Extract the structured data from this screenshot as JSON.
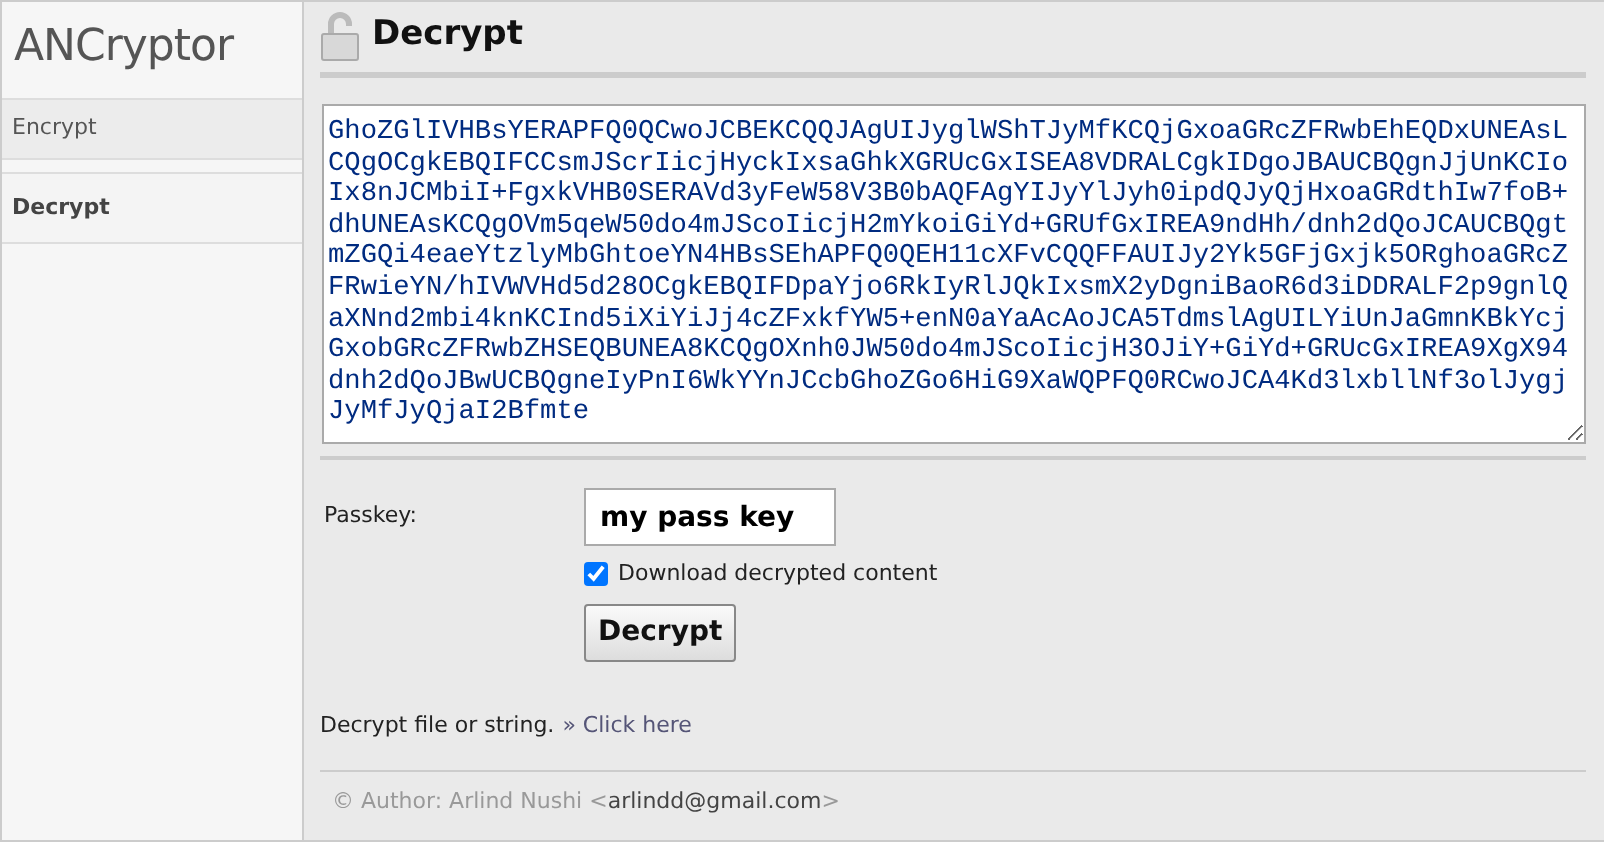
{
  "app_title": "ANCryptor",
  "nav": [
    {
      "label": "Encrypt",
      "selected": false
    },
    {
      "label": "Decrypt",
      "selected": true
    }
  ],
  "page_title": "Decrypt",
  "content_lines": [
    "GhoZGlIVHBsYERAPFQ0QCwoJCBEKCQQJAgUIJyglWShTJyMfKCQjGxoaGRcZFRwbEhEQDxUNEAsL",
    "CQgOCgkEBQIFCCsmJScrIicjHyckIxsaGhkXGRUcGxISEA8VDRALCgkIDgoJBAUCBQgnJjUnKCIo",
    "Ix8nJCMbiI+FgxkVHB0SERAVd3yFeW58V3B0bAQFAgYIJyYlJyh0ipdQJyQjHxoaGRdthIw7foB+",
    "dhUNEAsKCQgOVm5qeW50do4mJScoIicjH2mYkoiGiYd+GRUfGxIREA9ndHh/dnh2dQoJCAUCBQgt",
    "mZGQi4eaeYtzlyMbGhtoeYN4HBsSEhAPFQ0QEH11cXFvCQQFFAUIJy2Yk5GFjGxjk5ORghoaGRcZ",
    "FRwieYN/hIVWVHd5d28OCgkEBQIFDpaYjo6RkIyRlJQkIxsmX2yDgniBaoR6d3iDDRALF2p9gnlQ",
    "aXNnd2mbi4knKCInd5iXiYiJj4cZFxkfYW5+enN0aYaAcAoJCA5TdmslAgUILYiUnJaGmnKBkYcj",
    "GxobGRcZFRwbZHSEQBUNEA8KCQgOXnh0JW50do4mJScoIicjH3OJiY+GiYd+GRUcGxIREA9XgX94",
    "dnh2dQoJBwUCBQgneIyPnI6WkYYnJCcbGhoZGo6HiG9XaWQPFQ0RCwoJCA4Kd3lxbllNf3olJygj",
    "JyMfJyQjaI2Bfmte"
  ],
  "passkey": {
    "label": "Passkey:",
    "value": "my pass key"
  },
  "download": {
    "label": "Download decrypted content",
    "checked": true
  },
  "submit": "Decrypt",
  "hint": {
    "text": "Decrypt file or string.",
    "link": "» Click here"
  },
  "footer": {
    "author": "© Author: Arlind Nushi <",
    "email": "arlindd@gmail.com",
    "close": ">"
  }
}
